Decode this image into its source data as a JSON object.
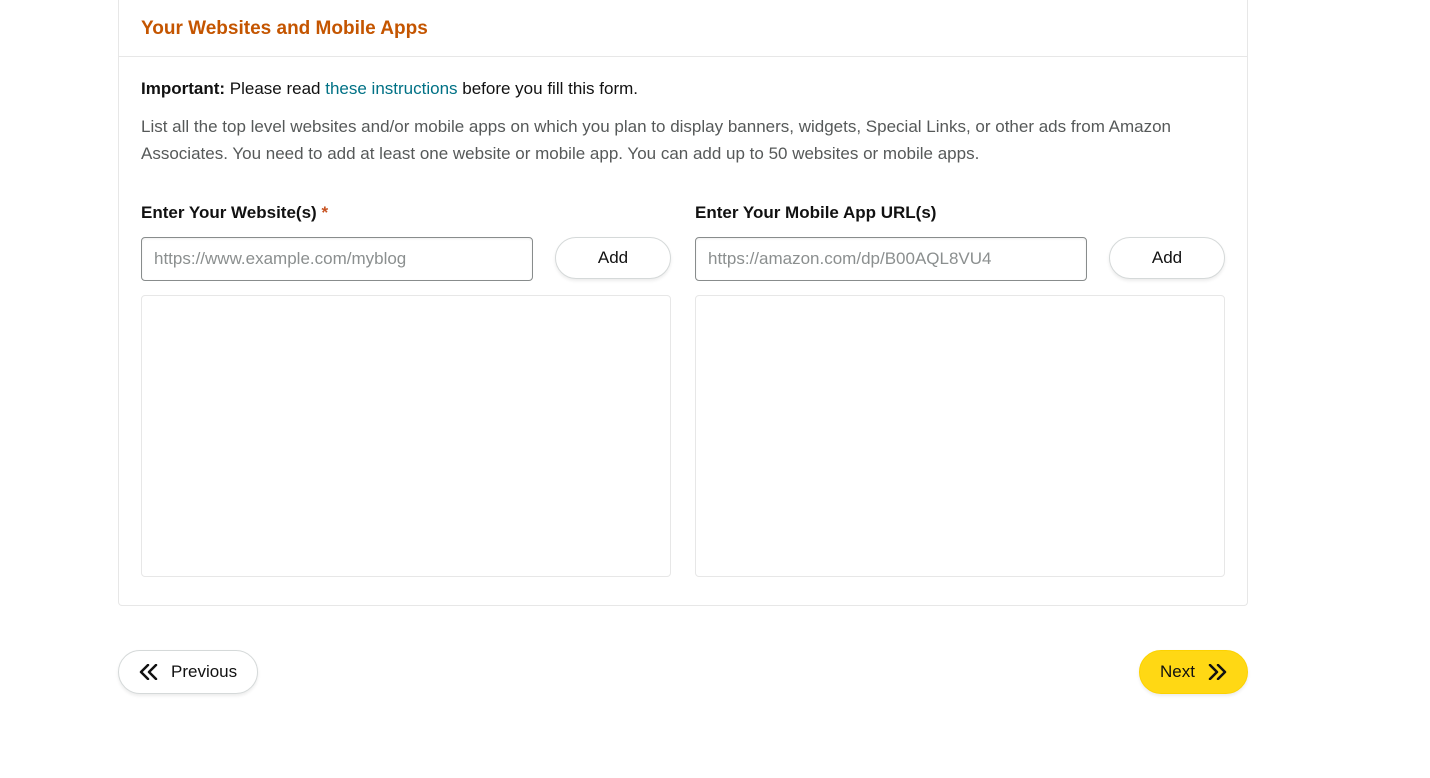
{
  "card": {
    "title": "Your Websites and Mobile Apps"
  },
  "notice": {
    "important_label": "Important:",
    "before_link": " Please read ",
    "link_text": "these instructions",
    "after_link": " before you fill this form."
  },
  "description": "List all the top level websites and/or mobile apps on which you plan to display banners, widgets, Special Links, or other ads from Amazon Associates. You need to add at least one website or mobile app. You can add up to 50 websites or mobile apps.",
  "websites": {
    "label": "Enter Your Website(s)",
    "required_mark": "*",
    "placeholder": "https://www.example.com/myblog",
    "value": "",
    "add_label": "Add"
  },
  "apps": {
    "label": "Enter Your Mobile App URL(s)",
    "placeholder": "https://amazon.com/dp/B00AQL8VU4",
    "value": "",
    "add_label": "Add"
  },
  "nav": {
    "previous": "Previous",
    "next": "Next"
  }
}
